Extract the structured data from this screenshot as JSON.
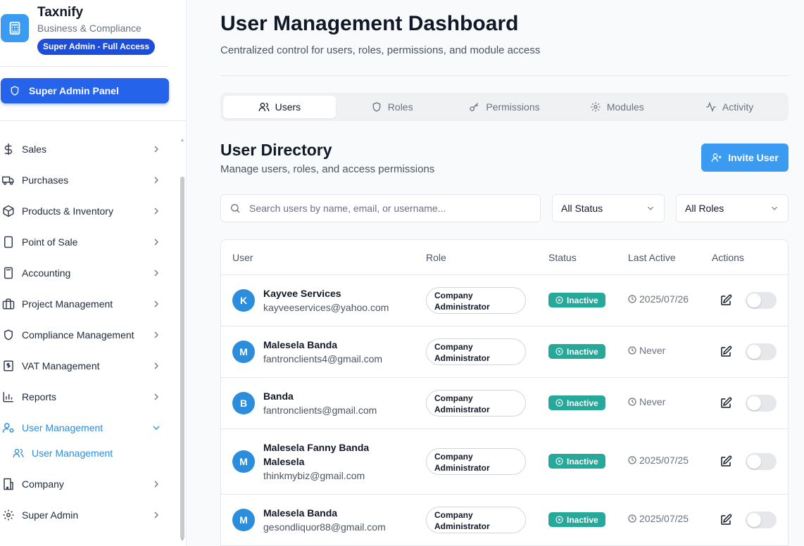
{
  "brand": {
    "title": "Taxnify",
    "subtitle": "Business & Compliance",
    "badge": "Super Admin - Full Access",
    "logo_icon": "calculator-icon"
  },
  "super_admin_panel": {
    "label": "Super Admin Panel",
    "icon": "shield-icon"
  },
  "sidebar": {
    "items": [
      {
        "label": "Sales",
        "icon": "dollar-icon"
      },
      {
        "label": "Purchases",
        "icon": "truck-icon"
      },
      {
        "label": "Products & Inventory",
        "icon": "box-icon"
      },
      {
        "label": "Point of Sale",
        "icon": "tablet-icon"
      },
      {
        "label": "Accounting",
        "icon": "calculator-icon"
      },
      {
        "label": "Project Management",
        "icon": "briefcase-icon"
      },
      {
        "label": "Compliance Management",
        "icon": "shield-icon"
      },
      {
        "label": "VAT Management",
        "icon": "receipt-icon"
      },
      {
        "label": "Reports",
        "icon": "bar-chart-icon"
      },
      {
        "label": "User Management",
        "icon": "user-cog-icon",
        "expanded": true
      },
      {
        "label": "Company",
        "icon": "building-icon"
      },
      {
        "label": "Super Admin",
        "icon": "gear-icon"
      }
    ],
    "sub_item": {
      "label": "User Management",
      "icon": "users-icon"
    }
  },
  "header": {
    "title": "User Management Dashboard",
    "subtitle": "Centralized control for users, roles, permissions, and module access"
  },
  "tabs": [
    {
      "label": "Users",
      "icon": "users-icon",
      "active": true
    },
    {
      "label": "Roles",
      "icon": "shield-icon"
    },
    {
      "label": "Permissions",
      "icon": "key-icon"
    },
    {
      "label": "Modules",
      "icon": "gear-icon"
    },
    {
      "label": "Activity",
      "icon": "activity-icon"
    }
  ],
  "directory": {
    "title": "User Directory",
    "subtitle": "Manage users, roles, and access permissions",
    "invite_label": "Invite User"
  },
  "filters": {
    "search_placeholder": "Search users by name, email, or username...",
    "status_value": "All Status",
    "role_value": "All Roles"
  },
  "table": {
    "columns": [
      "User",
      "Role",
      "Status",
      "Last Active",
      "Actions"
    ],
    "rows": [
      {
        "initial": "K",
        "name": "Kayvee Services",
        "name2": "",
        "email": "kayveeservices@yahoo.com",
        "role1": "Company",
        "role2": "Administrator",
        "status": "Inactive",
        "last_active": "2025/07/26"
      },
      {
        "initial": "M",
        "name": "Malesela Banda",
        "name2": "",
        "email": "fantronclients4@gmail.com",
        "role1": "Company",
        "role2": "Administrator",
        "status": "Inactive",
        "last_active": "Never"
      },
      {
        "initial": "B",
        "name": "Banda",
        "name2": "",
        "email": "fantronclients@gmail.com",
        "role1": "Company",
        "role2": "Administrator",
        "status": "Inactive",
        "last_active": "Never"
      },
      {
        "initial": "M",
        "name": "Malesela Fanny Banda",
        "name2": "Malesela",
        "email": "thinkmybiz@gmail.com",
        "role1": "Company",
        "role2": "Administrator",
        "status": "Inactive",
        "last_active": "2025/07/25"
      },
      {
        "initial": "M",
        "name": "Malesela Banda",
        "name2": "",
        "email": "gesondliquor88@gmail.com",
        "role1": "Company",
        "role2": "Administrator",
        "status": "Inactive",
        "last_active": "2025/07/25"
      }
    ]
  },
  "colors": {
    "primary": "#2563eb",
    "accent": "#3b9bf0",
    "active_nav": "#2b8ddb",
    "status_inactive": "#26a89a"
  }
}
